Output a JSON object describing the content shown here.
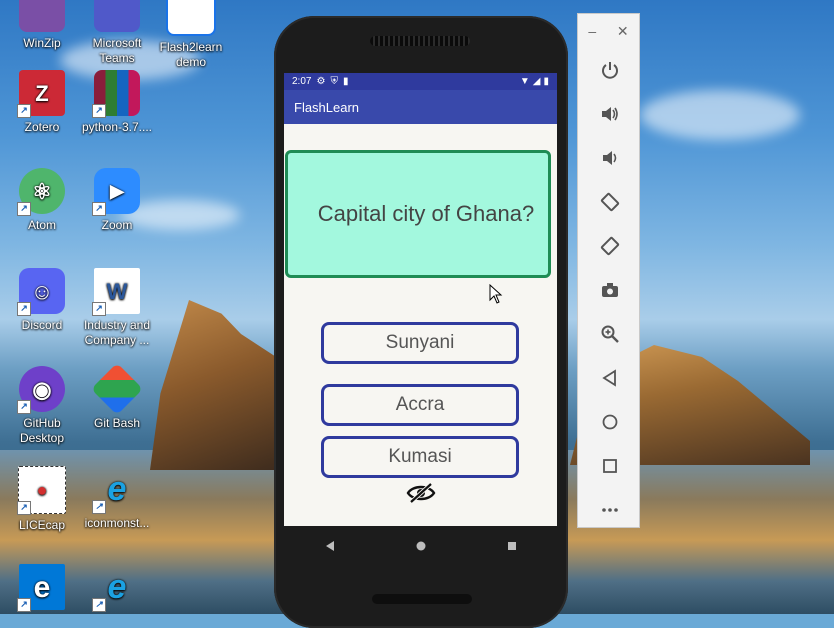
{
  "desktop": {
    "icons": [
      {
        "label": "WinZip",
        "icon": "winzip-icon",
        "color": "#7a4fa6"
      },
      {
        "label": "Microsoft Teams",
        "icon": "teams-icon",
        "color": "#5059c9"
      },
      {
        "label": "Flash2learn demo",
        "icon": "document-icon",
        "color": "#1a73e8"
      },
      {
        "label": "Zotero",
        "icon": "zotero-icon",
        "color": "#cc2936",
        "glyph": "Z"
      },
      {
        "label": "python-3.7....",
        "icon": "winrar-icon",
        "color": "#8a1d3b"
      },
      {
        "label": "Atom",
        "icon": "atom-icon",
        "color": "#4fb56c"
      },
      {
        "label": "Zoom",
        "icon": "zoom-icon",
        "color": "#2d8cff"
      },
      {
        "label": "Discord",
        "icon": "discord-icon",
        "color": "#5865f2"
      },
      {
        "label": "Industry and Company ...",
        "icon": "word-doc-icon",
        "color": "#2b579a",
        "glyph": "W"
      },
      {
        "label": "GitHub Desktop",
        "icon": "github-desktop-icon",
        "color": "#6e40c9"
      },
      {
        "label": "Git Bash",
        "icon": "git-bash-icon",
        "color": "#f05033"
      },
      {
        "label": "LICEcap",
        "icon": "licecap-icon",
        "color": "#ffffff"
      },
      {
        "label": "iconmonst...",
        "icon": "internet-explorer-icon",
        "color": "#1ba1e2"
      },
      {
        "label": "",
        "icon": "edge-icon",
        "color": "#0078d7"
      },
      {
        "label": "",
        "icon": "internet-explorer-icon",
        "color": "#1ba1e2"
      }
    ]
  },
  "phone": {
    "statusbar": {
      "time": "2:07"
    },
    "appbar": {
      "title": "FlashLearn"
    },
    "question": "Capital city of Ghana?",
    "answers": [
      "Sunyani",
      "Accra",
      "Kumasi"
    ],
    "colors": {
      "primary": "#3949ab",
      "card_bg": "#a3f8de",
      "card_border": "#1f8c55",
      "answer_border": "#2f3a9e"
    }
  },
  "emulator": {
    "window_controls": [
      "minimize",
      "close"
    ],
    "buttons": [
      "power-icon",
      "volume-up-icon",
      "volume-down-icon",
      "rotate-left-icon",
      "rotate-right-icon",
      "camera-icon",
      "zoom-icon",
      "back-icon",
      "home-icon",
      "overview-icon",
      "more-icon"
    ]
  }
}
